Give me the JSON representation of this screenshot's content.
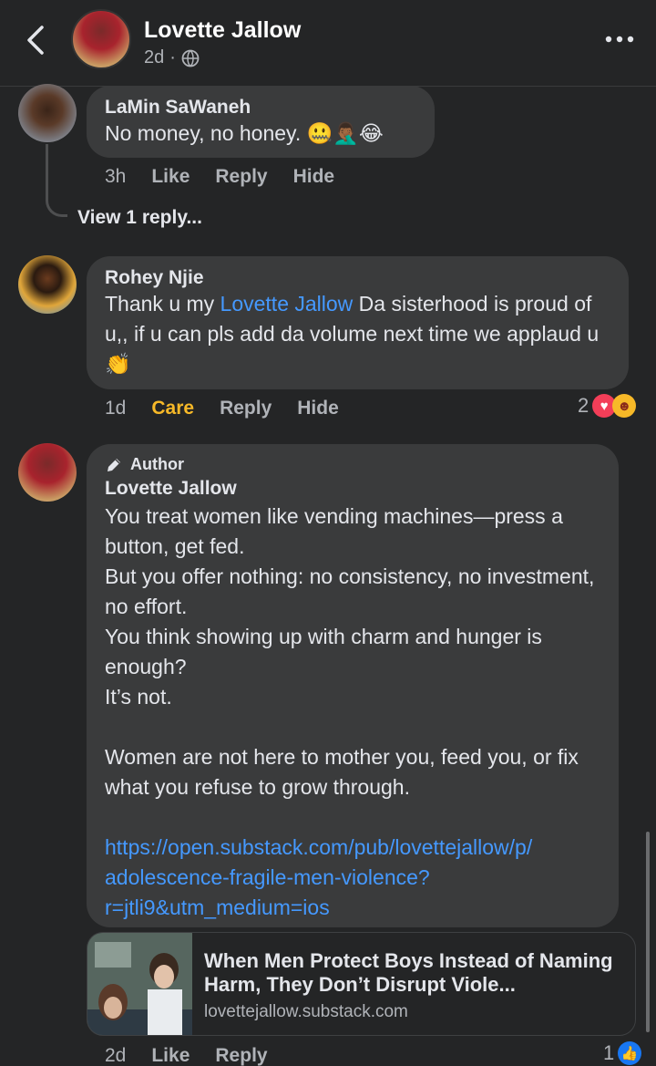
{
  "header": {
    "title": "Lovette Jallow",
    "time": "2d",
    "dot": "·",
    "back_icon": "chevron-left-icon",
    "privacy_icon": "globe-icon",
    "more_icon": "more-horizontal-icon"
  },
  "comments": [
    {
      "name": "LaMin SaWaneh",
      "text": "No money, no honey.",
      "emojis": "🤐🤦🏾‍♂️😂",
      "time": "3h",
      "actions": [
        "Like",
        "Reply",
        "Hide"
      ]
    },
    {
      "name": "Rohey Njie",
      "text_before": "Thank u my ",
      "mention": "Lovette Jallow",
      "text_after": " Da sisterhood is proud of u,, if u can pls add da volume next time we applaud u",
      "emoji": "👏",
      "time": "1d",
      "reaction_label": "Care",
      "actions": [
        "Reply",
        "Hide"
      ],
      "reaction_count": "2"
    },
    {
      "badge": "Author",
      "name": "Lovette Jallow",
      "paragraphs": [
        "You treat women like vending machines—press a button, get fed.",
        "But you offer nothing: no consistency, no investment, no effort.",
        "You think showing up with charm and hunger is enough?",
        "It’s not."
      ],
      "paragraph2": "Women are not here to mother you, feed you, or fix what you refuse to grow through.",
      "link_line1": "https://open.substack.com/pub/lovettejallow/p/",
      "link_line2": "adolescence-fragile-men-violence?",
      "link_line3": "r=jtli9&utm_medium=ios",
      "preview": {
        "title": "When Men Protect Boys Instead of Naming Harm, They Don’t Disrupt Viole...",
        "domain": "lovettejallow.substack.com"
      },
      "time": "2d",
      "actions": [
        "Like",
        "Reply"
      ],
      "reaction_count": "1"
    }
  ],
  "view_replies": "View 1 reply...",
  "colors": {
    "background": "#242526",
    "bubble": "#3a3b3c",
    "link": "#4599ff",
    "care": "#f7b928",
    "like_blue": "#1877f2",
    "love_red": "#f33e58"
  }
}
